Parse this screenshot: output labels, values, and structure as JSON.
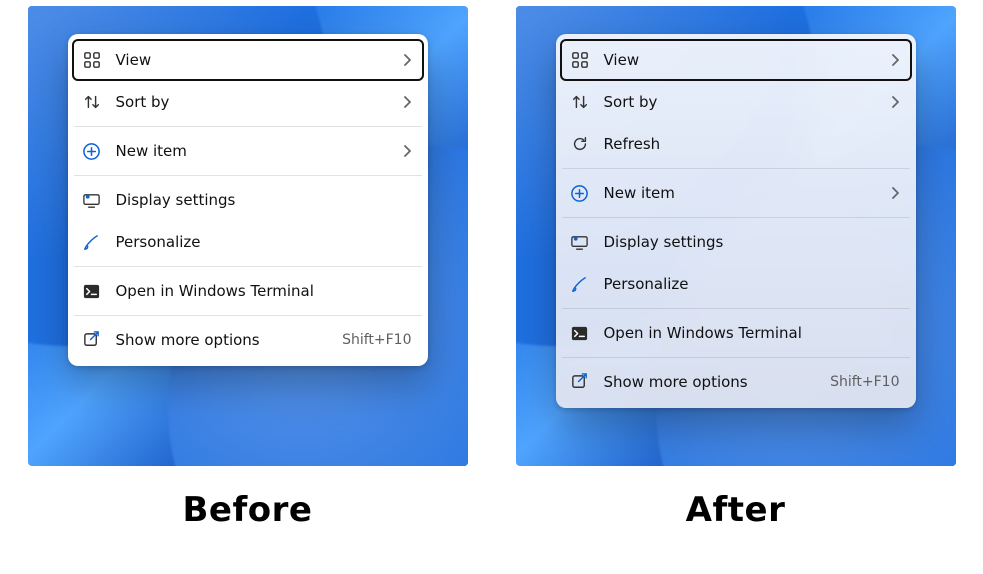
{
  "captions": {
    "before": "Before",
    "after": "After"
  },
  "before_menu": {
    "view": {
      "label": "View"
    },
    "sort_by": {
      "label": "Sort by"
    },
    "new_item": {
      "label": "New item"
    },
    "display_settings": {
      "label": "Display settings"
    },
    "personalize": {
      "label": "Personalize"
    },
    "open_terminal": {
      "label": "Open in Windows Terminal"
    },
    "show_more": {
      "label": "Show more options",
      "shortcut": "Shift+F10"
    }
  },
  "after_menu": {
    "view": {
      "label": "View"
    },
    "sort_by": {
      "label": "Sort by"
    },
    "refresh": {
      "label": "Refresh"
    },
    "new_item": {
      "label": "New item"
    },
    "display_settings": {
      "label": "Display settings"
    },
    "personalize": {
      "label": "Personalize"
    },
    "open_terminal": {
      "label": "Open in Windows Terminal"
    },
    "show_more": {
      "label": "Show more options",
      "shortcut": "Shift+F10"
    }
  }
}
